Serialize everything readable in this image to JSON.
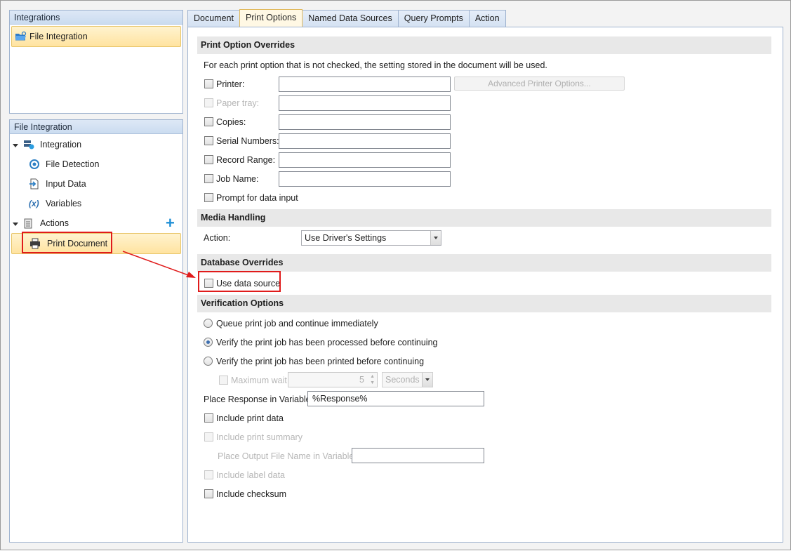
{
  "left": {
    "integrations_header": "Integrations",
    "integrations_item": "File Integration",
    "tree_header": "File Integration",
    "tree": {
      "integration": "Integration",
      "file_detection": "File Detection",
      "input_data": "Input Data",
      "variables": "Variables",
      "actions": "Actions",
      "print_document": "Print Document"
    }
  },
  "tabs": [
    "Document",
    "Print Options",
    "Named Data Sources",
    "Query Prompts",
    "Action"
  ],
  "active_tab": "Print Options",
  "print_overrides": {
    "header": "Print Option Overrides",
    "description": "For each print option that is not checked, the setting stored in the document will be used.",
    "printer": "Printer:",
    "advanced_button": "Advanced Printer Options...",
    "paper_tray": "Paper tray:",
    "copies": "Copies:",
    "serial_numbers": "Serial Numbers:",
    "record_range": "Record Range:",
    "job_name": "Job Name:",
    "prompt": "Prompt for data input"
  },
  "media": {
    "header": "Media Handling",
    "action_label": "Action:",
    "action_value": "Use Driver's Settings"
  },
  "database": {
    "header": "Database Overrides",
    "use_data_source": "Use data source"
  },
  "verification": {
    "header": "Verification Options",
    "queue": "Queue print job and continue immediately",
    "processed": "Verify the print job has been processed before continuing",
    "printed": "Verify the print job has been printed before continuing",
    "max_wait": "Maximum wait time",
    "wait_value": "5",
    "wait_unit": "Seconds",
    "place_response": "Place Response in Variable:",
    "response_value": "%Response%",
    "include_print_data": "Include print data",
    "include_print_summary": "Include print summary",
    "place_output": "Place Output File Name in Variable:",
    "include_label_data": "Include label data",
    "include_checksum": "Include checksum"
  },
  "colors": {
    "selection": "#ffe3a0",
    "highlight": "#e01b1b",
    "accent": "#1f8fd6"
  }
}
